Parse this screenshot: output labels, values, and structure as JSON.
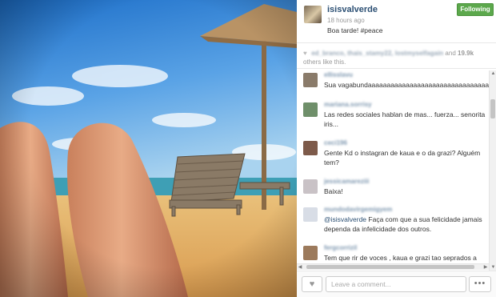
{
  "post": {
    "username": "isisvalverde",
    "timestamp": "18 hours ago",
    "caption": "Boa tarde! #peace",
    "follow_label": "Following"
  },
  "likes": {
    "likers": "ed_branco, thais_stamy22, lostmyselfagain",
    "mid": " and ",
    "count": "19.9k",
    "suffix": "others like this."
  },
  "comments": [
    {
      "user": "ellisslavu",
      "avatar_color": "#8a7b6a",
      "segments": [
        {
          "text": "Sua vagabundaaaaaaaaaaaaaaaaaaaaaaaaaaaaaaaaaaaaaaaaaaaa",
          "mention": false
        }
      ]
    },
    {
      "user": "mariana.sorrisy",
      "avatar_color": "#6f8f6a",
      "segments": [
        {
          "text": "Las redes sociales hablan de mas... fuerza... senorita iris...",
          "mention": false
        }
      ]
    },
    {
      "user": "ceci196",
      "avatar_color": "#7d5a4a",
      "segments": [
        {
          "text": "Gente Kd o instagran de kaua e o da grazi? Alguém tem?",
          "mention": false
        }
      ]
    },
    {
      "user": "jessicamareziii",
      "avatar_color": "#c9c2c6",
      "segments": [
        {
          "text": "Baixa!",
          "mention": false
        }
      ]
    },
    {
      "user": "mundodavirgemigyem",
      "avatar_color": "#d8dde6",
      "segments": [
        {
          "text": "@isisvalverde",
          "mention": true
        },
        {
          "text": " Faça com que a sua felicidade jamais dependa da infelicidade dos outros.",
          "mention": false
        }
      ]
    },
    {
      "user": "fergcorrizil",
      "avatar_color": "#9c7a5c",
      "segments": [
        {
          "text": "Tem que rir de voces , kaua e grazi tao seprados a meses , so nao puderam anunciar tal separacao por causa dos contratos de comerciais midias etc... agora",
          "mention": false
        }
      ]
    }
  ],
  "footer": {
    "comment_placeholder": "Leave a comment...",
    "more_label": "•••",
    "heart_glyph": "♥"
  },
  "scroll": {
    "up": "▲",
    "down": "▼",
    "left": "◀",
    "right": "▶"
  }
}
